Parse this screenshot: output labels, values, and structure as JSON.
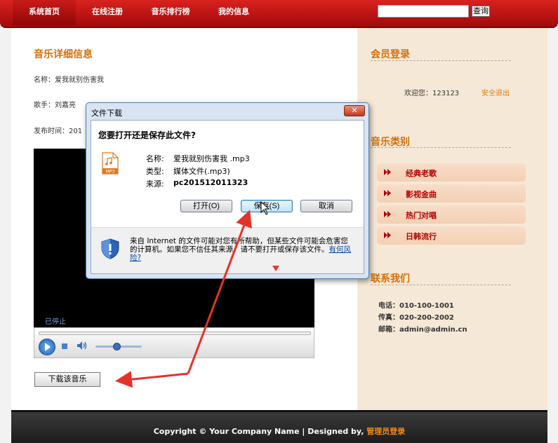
{
  "nav": {
    "items": [
      "系统首页",
      "在线注册",
      "音乐排行榜",
      "我的信息"
    ],
    "search_placeholder": "",
    "search_button": "查询"
  },
  "main": {
    "title": "音乐详细信息",
    "name_line": "名称：爱我就别伤害我",
    "singer_line": "歌手：刘嘉亮",
    "publish_line": "发布时间：201",
    "player": {
      "status": "已停止",
      "volume_level": 0.45
    },
    "download_button": "下载该音乐"
  },
  "sidebar": {
    "login_title": "会员登录",
    "welcome": "欢迎您：123123",
    "logout": "安全退出",
    "category_title": "音乐类别",
    "categories": [
      "经典老歌",
      "影视金曲",
      "热门对唱",
      "日韩流行"
    ],
    "contact_title": "联系我们",
    "contact": {
      "phone": "电话：010-100-1001",
      "fax": "传真：020-200-2002",
      "email": "邮箱：admin@admin.cn"
    }
  },
  "dialog": {
    "title": "文件下载",
    "close": "✕",
    "question": "您要打开还是保存此文件?",
    "name_label": "名称:",
    "name_value": "爱我就别伤害我 .mp3",
    "type_label": "类型:",
    "type_value": "媒体文件(.mp3)",
    "source_label": "来源:",
    "source_value": "pc201512011323",
    "open_button": "打开(O)",
    "save_button": "保存(S)",
    "cancel_button": "取消",
    "warning": "来自 Internet 的文件可能对您有所帮助，但某些文件可能会危害您的计算机。如果您不信任其来源，请不要打开或保存该文件。",
    "risk_link": "有何风险?",
    "file_icon_text": "MP3"
  },
  "footer": {
    "text": "Copyright © Your Company Name | Designed by,",
    "admin_link": "管理员登录"
  },
  "colors": {
    "accent_red": "#c0120f",
    "title_orange": "#d46f0a",
    "sidebar_bg": "#f6e8d6",
    "annotation_red": "#e8302a"
  }
}
